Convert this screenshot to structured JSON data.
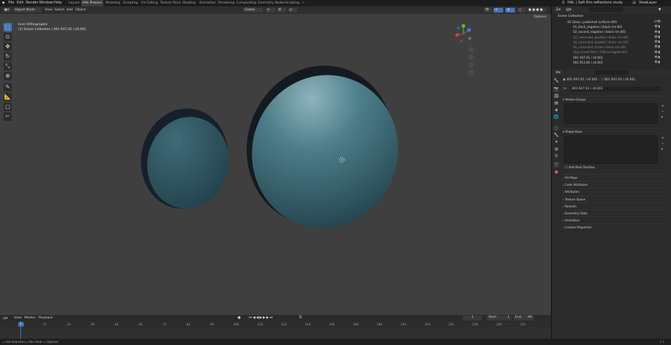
{
  "menu": [
    "File",
    "Edit",
    "Render",
    "Window",
    "Help"
  ],
  "workspaces": [
    "Layout",
    "HAL Process",
    "Modeling",
    "Sculpting",
    "UV Editing",
    "Texture Paint",
    "Shading",
    "Animation",
    "Rendering",
    "Compositing",
    "Geometry Nodes",
    "Scripting"
  ],
  "active_workspace": "HAL Process",
  "scene_name": "HAL | Soft film reflections study",
  "view_layer": "ViewLayer",
  "viewport": {
    "mode": "Object Mode",
    "menus": [
      "View",
      "Select",
      "Add",
      "Object"
    ],
    "orientation": "Global",
    "options": "Options",
    "info_line1": "User Orthographic",
    "info_line2": "(1) Scene Collection | 001 R47.01 / z0.001",
    "colors": {
      "background": "#3f3f3f",
      "lens_light": "#6b9aa6",
      "lens_dark": "#1f3a42",
      "rim": "#1b2326"
    }
  },
  "outliner": {
    "header": "Scene Collection",
    "items": [
      {
        "label": "01 Glass / published surfaces.001",
        "dim": false
      },
      {
        "label": "01_front_negative / black rim.001",
        "dim": false
      },
      {
        "label": "02_second_negative / black rim.001",
        "dim": false
      },
      {
        "label": "03_cemented_doublet / black rim.001",
        "dim": true
      },
      {
        "label": "04_cemented_doublet / black rim.001",
        "dim": true
      },
      {
        "label": "05_cemented_triplet / black rim.001",
        "dim": true
      },
      {
        "label": "Stop (small film) / f/28 surrogate.001",
        "dim": true
      },
      {
        "label": "001 R47.01 / z0.001",
        "dim": false
      },
      {
        "label": "002 R13.85 / z0.001",
        "dim": false
      }
    ]
  },
  "properties": {
    "object": "001 R47.01 / z0.001",
    "mesh": "001 R47.01 / z0.001",
    "data_name": "001 R47.01 / z0.001",
    "sections": {
      "vertex_groups": "Vertex Groups",
      "shape_keys": "Shape Keys",
      "add_rest_position": "Add Rest Position",
      "rest": [
        "UV Maps",
        "Color Attributes",
        "Attributes",
        "Texture Space",
        "Remesh",
        "Geometry Data",
        "Animation",
        "Custom Properties"
      ]
    }
  },
  "timeline": {
    "menus": [
      "View",
      "Marker",
      "Playback"
    ],
    "current_frame": "1",
    "start_label": "Start",
    "start": "1",
    "end_label": "End",
    "end": "96",
    "ticks": [
      "1",
      "12",
      "24",
      "36",
      "48",
      "60",
      "72",
      "84",
      "96",
      "108",
      "120",
      "132",
      "144",
      "156",
      "168",
      "180",
      "192",
      "204",
      "216",
      "228",
      "240",
      "252"
    ],
    "playhead": "1"
  },
  "statusbar": {
    "left": [
      "Set Selection",
      "Pan View",
      "Options"
    ],
    "version": "4.1"
  }
}
